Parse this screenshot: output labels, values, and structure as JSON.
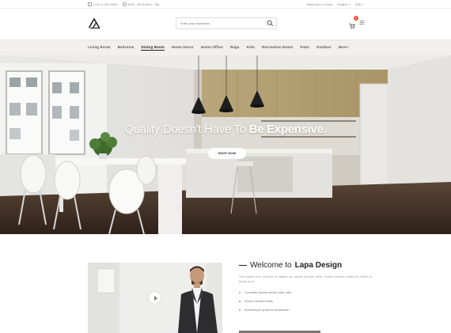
{
  "topbar": {
    "phone": "(+0) 12 620 5926",
    "hours": "8:00 - 18:00 Mon - Sat",
    "welcome": "Welcome to Guest",
    "language": "English",
    "currency": "USD"
  },
  "header": {
    "search_placeholder": "Enter your keywords...",
    "cart_count": "0"
  },
  "nav": {
    "items": [
      "Living Room",
      "Bedroom",
      "Dining Room",
      "Home Decor",
      "Home Office",
      "Rugs",
      "Kids",
      "Recreation Room",
      "Patio",
      "Outdoor",
      "More"
    ]
  },
  "hero": {
    "title_regular": "Quality Doesn't Have To ",
    "title_bold": "Be Expensive.",
    "button_label": "SHOP NOW"
  },
  "welcome": {
    "title_regular": "Welcome to ",
    "title_bold": "Lapa Design",
    "description": "Sed sapien orci, rhoncus eu sapien ac, iaculis semper dolor. Donec lobortis mattis dui. Morbi ut turpis nunc.",
    "bullets": [
      "Curabitur lacinia metus vitae odio",
      "Donec lacinia mattis",
      "Scelerisque quam id vestibulum"
    ]
  },
  "colors": {
    "accent": "#e14b3b",
    "nav_bg": "#f1f0ee",
    "bar": "#7a746c"
  }
}
